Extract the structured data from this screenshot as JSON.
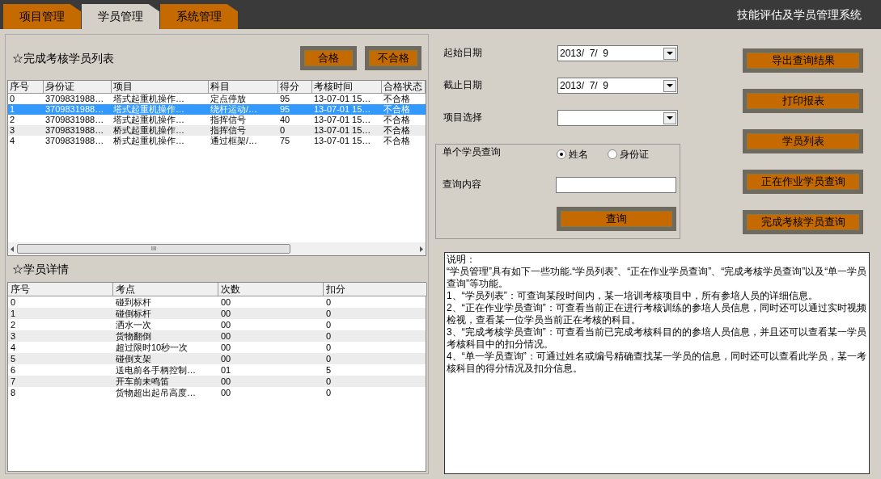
{
  "tabs": [
    {
      "label": "项目管理",
      "selected": false
    },
    {
      "label": "学员管理",
      "selected": true
    },
    {
      "label": "系统管理",
      "selected": false
    }
  ],
  "app_title": "技能评估及学员管理系统",
  "results": {
    "title": "☆完成考核学员列表",
    "buttons": [
      "合格",
      "不合格"
    ],
    "columns": [
      "序号",
      "身份证",
      "项目",
      "科目",
      "得分",
      "考核时间",
      "合格状态"
    ],
    "rows": [
      {
        "cells": [
          "0",
          "3709831988…",
          "塔式起重机操作…",
          "定点停放",
          "95",
          "13-07-01 15…",
          "不合格"
        ],
        "selected": false
      },
      {
        "cells": [
          "1",
          "3709831988…",
          "塔式起重机操作…",
          "绕杆运动/…",
          "95",
          "13-07-01 15…",
          "不合格"
        ],
        "selected": true
      },
      {
        "cells": [
          "2",
          "3709831988…",
          "塔式起重机操作…",
          "指挥信号",
          "40",
          "13-07-01 15…",
          "不合格"
        ],
        "selected": false
      },
      {
        "cells": [
          "3",
          "3709831988…",
          "桥式起重机操作…",
          "指挥信号",
          "0",
          "13-07-01 15…",
          "不合格"
        ],
        "selected": false
      },
      {
        "cells": [
          "4",
          "3709831988…",
          "桥式起重机操作…",
          "通过框架/…",
          "75",
          "13-07-01 15…",
          "不合格"
        ],
        "selected": false
      }
    ],
    "scroll_grip": "III"
  },
  "details": {
    "title": "☆学员详情",
    "columns": [
      "序号",
      "考点",
      "次数",
      "扣分"
    ],
    "rows": [
      [
        "0",
        "碰到标杆",
        "00",
        "0"
      ],
      [
        "1",
        "碰倒标杆",
        "00",
        "0"
      ],
      [
        "2",
        "洒水一次",
        "00",
        "0"
      ],
      [
        "3",
        "货物翻倒",
        "00",
        "0"
      ],
      [
        "4",
        "超过限时10秒一次",
        "00",
        "0"
      ],
      [
        "5",
        "碰倒支架",
        "00",
        "0"
      ],
      [
        "6",
        "送电前各手柄控制…",
        "01",
        "5"
      ],
      [
        "7",
        "开车前未鸣笛",
        "00",
        "0"
      ],
      [
        "8",
        "货物超出起吊高度…",
        "00",
        "0"
      ]
    ]
  },
  "query": {
    "start_label": "起始日期",
    "start_value": "2013/  7/  9",
    "end_label": "截止日期",
    "end_value": "2013/  7/  9",
    "project_label": "项目选择",
    "single_label": "单个学员查询",
    "radios": [
      {
        "label": "姓名",
        "selected": true
      },
      {
        "label": "身份证",
        "selected": false
      }
    ],
    "content_label": "查询内容",
    "search_button": "查询"
  },
  "actions": [
    "导出查询结果",
    "打印报表",
    "学员列表",
    "正在作业学员查询",
    "完成考核学员查询"
  ],
  "notes": [
    "说明：",
    "“学员管理”具有如下一些功能.“学员列表”、“正在作业学员查询”、“完成考核学员查询”以及“单一学员查询”等功能。",
    "1、“学员列表”：可查询某段时间内，某一培训考核项目中，所有参培人员的详细信息。",
    "2、“正在作业学员查询”：可查看当前正在进行考核训练的参培人员信息，同时还可以通过实时视频检视，查看某一位学员当前正在考核的科目。",
    "3、“完成考核学员查询”：可查看当前已完成考核科目的的参培人员信息，并且还可以查看某一学员考核科目中的扣分情况。",
    "4、“单一学员查询”：可通过姓名或编号精确查找某一学员的信息，同时还可以查看此学员，某一考核科目的得分情况及扣分信息。"
  ]
}
